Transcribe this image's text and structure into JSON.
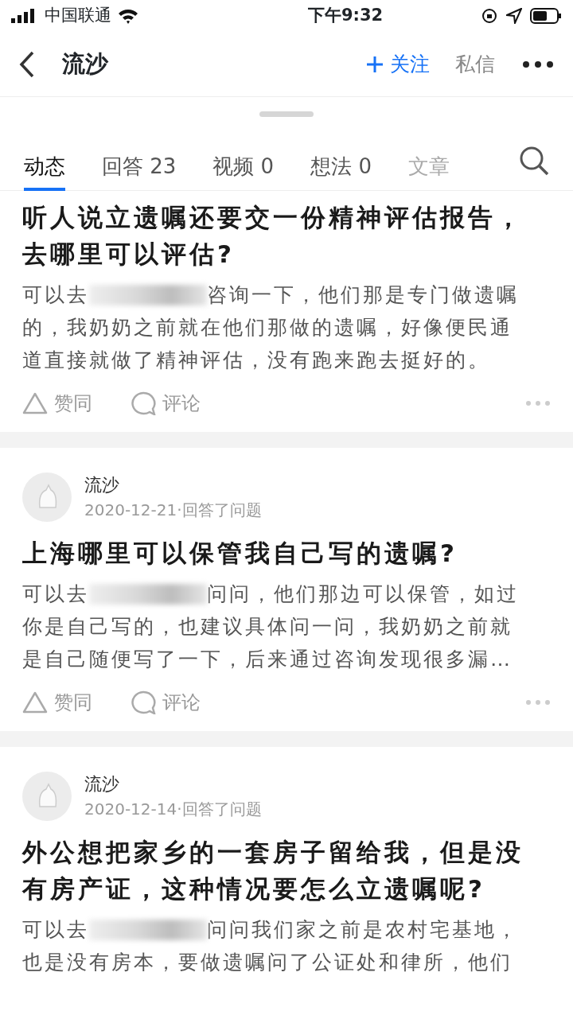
{
  "status_bar": {
    "carrier": "中国联通",
    "time": "下午9:32"
  },
  "header": {
    "title": "流沙",
    "follow": "关注",
    "message": "私信"
  },
  "tabs": [
    {
      "label": "动态",
      "selected": true
    },
    {
      "label": "回答 23",
      "selected": false
    },
    {
      "label": "视频 0",
      "selected": false
    },
    {
      "label": "想法 0",
      "selected": false
    },
    {
      "label": "文章",
      "selected": false
    }
  ],
  "feed": [
    {
      "question": "听人说立遗嘱还要交一份精神评估报告，去哪里可以评估?",
      "answer_lines": [
        [
          {
            "kind": "text",
            "text": "可以去"
          },
          {
            "kind": "blur"
          },
          {
            "kind": "text",
            "text": "咨询一下，他们那是专门做遗嘱"
          }
        ],
        [
          {
            "kind": "text",
            "text": "的，我奶奶之前就在他们那做的遗嘱，好像便民通"
          }
        ],
        [
          {
            "kind": "text",
            "text": "道直接就做了精神评估，没有跑来跑去挺好的。"
          }
        ]
      ],
      "actions": [
        "赞同",
        "评论"
      ]
    },
    {
      "author": "流沙",
      "meta": "2020-12-21·回答了问题",
      "question": "上海哪里可以保管我自己写的遗嘱?",
      "answer_lines": [
        [
          {
            "kind": "text",
            "text": "可以去"
          },
          {
            "kind": "blur"
          },
          {
            "kind": "text",
            "text": "问问，他们那边可以保管，如过"
          }
        ],
        [
          {
            "kind": "text",
            "text": "你是自己写的，也建议具体问一问，我奶奶之前就"
          }
        ],
        [
          {
            "kind": "text",
            "text": "是自己随便写了一下，后来通过咨询发现很多漏…"
          }
        ]
      ],
      "actions": [
        "赞同",
        "评论"
      ]
    },
    {
      "author": "流沙",
      "meta": "2020-12-14·回答了问题",
      "question": "外公想把家乡的一套房子留给我，但是没有房产证，这种情况要怎么立遗嘱呢?",
      "answer_lines": [
        [
          {
            "kind": "text",
            "text": "可以去"
          },
          {
            "kind": "blur"
          },
          {
            "kind": "text",
            "text": "问问我们家之前是农村宅基地，"
          }
        ],
        [
          {
            "kind": "text",
            "text": "也是没有房本，要做遗嘱问了公证处和律所，他们"
          }
        ]
      ]
    }
  ]
}
